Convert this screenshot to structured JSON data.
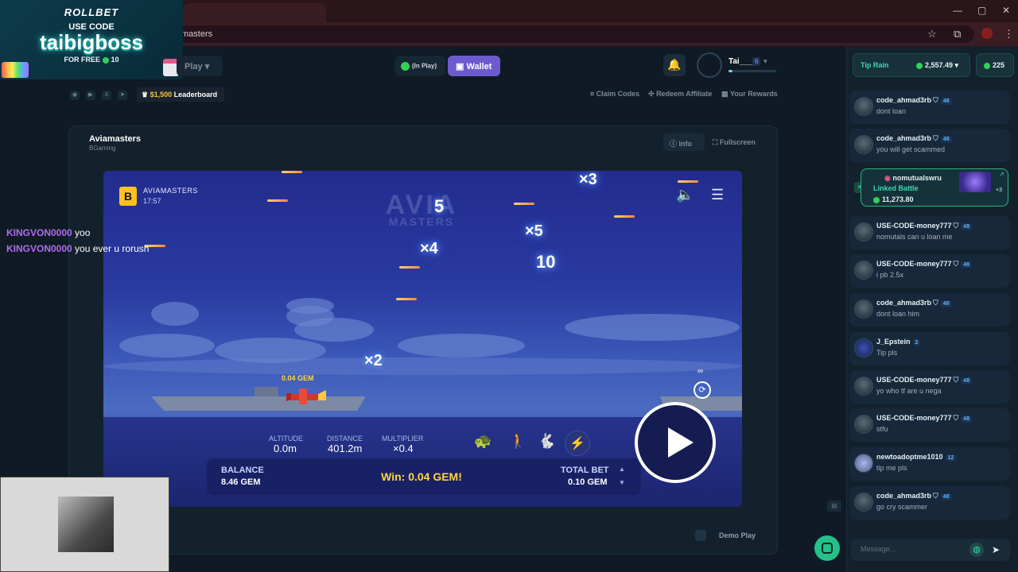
{
  "browser": {
    "tab_title": "masters",
    "url": "masters",
    "win_min": "—",
    "win_max": "▢",
    "win_close": "✕",
    "bookmark_icon": "star-icon",
    "ext_icon": "extensions-icon",
    "menu_icon": "⋮"
  },
  "promo": {
    "logo": "ROLLBET",
    "use_code": "USE CODE",
    "code": "taibigboss",
    "free": "FOR FREE",
    "free_amount": "10"
  },
  "header": {
    "play_label": "Play",
    "in_play_label": "(In Play)",
    "wallet_label": "Wallet",
    "username": "Tai___",
    "user_level": "6",
    "xp_fraction": 0.08,
    "leaderboard_amount": "$1,500",
    "leaderboard_label": "Leaderboard",
    "claim_codes": "Claim Codes",
    "redeem_affiliate": "Redeem Affiliate",
    "your_rewards": "Your Rewards"
  },
  "game_card": {
    "title": "Aviamasters",
    "provider": "BGaming",
    "info_label": "Info",
    "fullscreen_label": "Fullscreen",
    "demo_play_label": "Demo Play"
  },
  "game": {
    "brand": "AVIAMASTERS",
    "time": "17:57",
    "bg_logo": "AVIA",
    "bg_logo_sub": "MASTERS",
    "multipliers": [
      "×3",
      "5",
      "×5",
      "×4",
      "10",
      "×2"
    ],
    "plane_win": "0.04 GEM",
    "altitude_label": "ALTITUDE",
    "altitude_value": "0.0m",
    "distance_label": "DISTANCE",
    "distance_value": "401.2m",
    "multiplier_label": "MULTIPLIER",
    "multiplier_value": "×0.4",
    "balance_label": "BALANCE",
    "balance_value": "8.46 GEM",
    "win_message": "Win: 0.04 GEM!",
    "total_bet_label": "TOTAL BET",
    "total_bet_value": "0.10 GEM",
    "infinity": "∞"
  },
  "twitch_chat": [
    {
      "user": "KINGVON0000",
      "message": "yoo"
    },
    {
      "user": "KINGVON0000",
      "message": "you ever u rorush"
    }
  ],
  "sidebar": {
    "tip_rain_label": "Tip Rain",
    "tip_rain_value": "2,557.49",
    "online_count": "225",
    "message_placeholder": "Message...",
    "messages": [
      {
        "user": "code_ahmad3rb",
        "level": "48",
        "text": "dont loan"
      },
      {
        "user": "code_ahmad3rb",
        "level": "48",
        "text": "you will get scammed"
      },
      {
        "user": "USE-CODE-money777",
        "level": "48",
        "text": "nomutals can u loan me"
      },
      {
        "user": "USE-CODE-money777",
        "level": "48",
        "text": "i pb 2.5x"
      },
      {
        "user": "code_ahmad3rb",
        "level": "48",
        "text": "dont loan him"
      },
      {
        "user": "J_Epstein",
        "level": "2",
        "text": "Tip pls"
      },
      {
        "user": "USE-CODE-money777",
        "level": "48",
        "text": "yo who tf are u nega"
      },
      {
        "user": "USE-CODE-money777",
        "level": "48",
        "text": "stfu"
      },
      {
        "user": "newtoadoptme1010",
        "level": "12",
        "text": "tip me pls"
      },
      {
        "user": "code_ahmad3rb",
        "level": "48",
        "text": "go cry scammer"
      }
    ],
    "battle": {
      "user": "nomutualswru",
      "label": "Linked Battle",
      "amount": "11,273.80",
      "extra": "+3"
    }
  }
}
